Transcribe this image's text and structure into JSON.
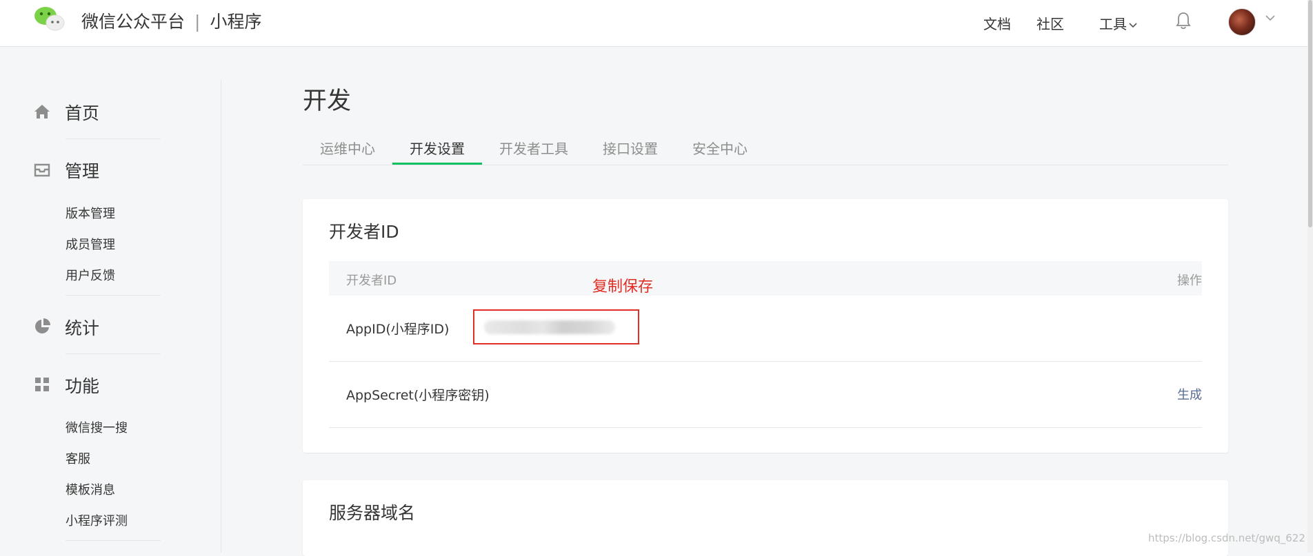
{
  "header": {
    "brand_name": "微信公众平台",
    "brand_separator": "|",
    "brand_product": "小程序",
    "nav": {
      "docs": "文档",
      "community": "社区",
      "tools": "工具"
    }
  },
  "sidebar": {
    "home": "首页",
    "manage": "管理",
    "manage_items": [
      "版本管理",
      "成员管理",
      "用户反馈"
    ],
    "stats": "统计",
    "features": "功能",
    "feature_items": [
      "微信搜一搜",
      "客服",
      "模板消息",
      "小程序评测"
    ]
  },
  "main": {
    "title": "开发",
    "tabs": [
      "运维中心",
      "开发设置",
      "开发者工具",
      "接口设置",
      "安全中心"
    ],
    "active_tab": "开发设置",
    "developer_id": {
      "title": "开发者ID",
      "col_id": "开发者ID",
      "col_action": "操作",
      "appid_label": "AppID(小程序ID)",
      "appsecret_label": "AppSecret(小程序密钥)",
      "generate_label": "生成"
    },
    "server_domain": {
      "title": "服务器域名"
    }
  },
  "annotation": {
    "text": "复制保存",
    "color": "#e02e24"
  },
  "watermark": "https://blog.csdn.net/gwq_622",
  "colors": {
    "accent_green": "#07c160",
    "link_blue": "#576b95",
    "annotation_red": "#e02e24"
  }
}
